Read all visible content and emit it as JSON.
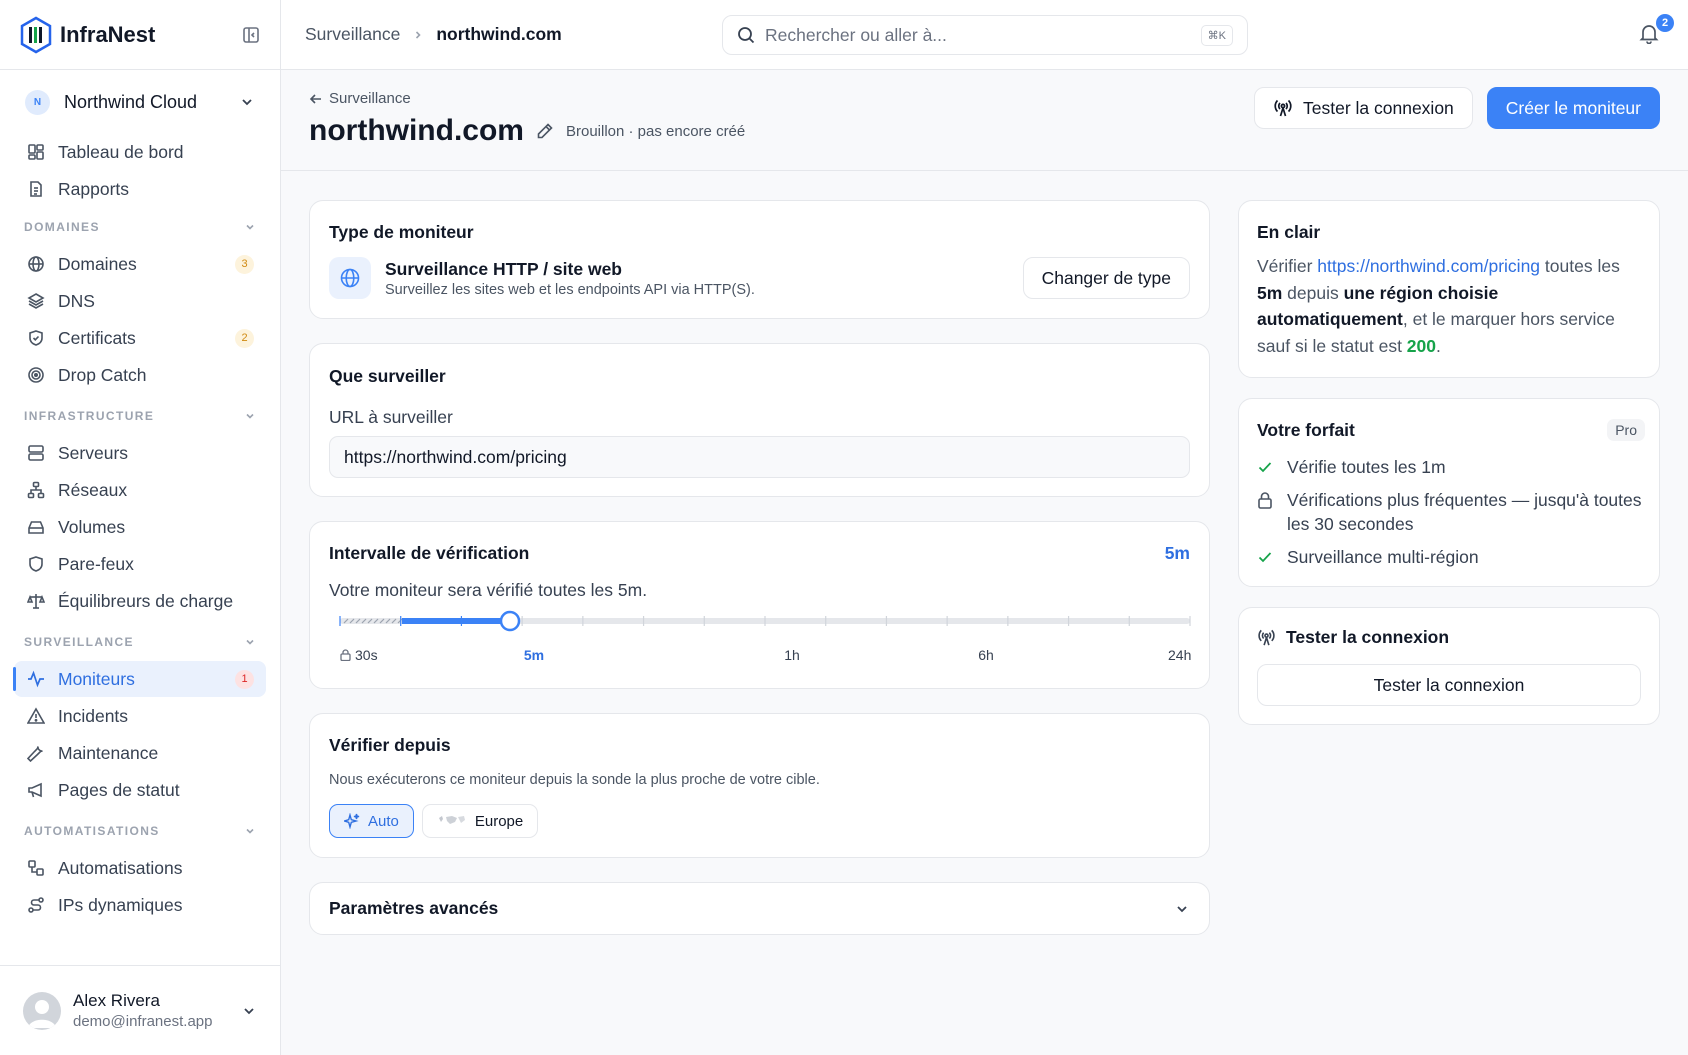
{
  "brand": {
    "name": "InfraNest"
  },
  "org": {
    "initial": "N",
    "name": "Northwind Cloud"
  },
  "nav": {
    "top": [
      {
        "label": "Tableau de bord",
        "icon": "dashboard-icon"
      },
      {
        "label": "Rapports",
        "icon": "report-icon"
      }
    ],
    "sections": [
      {
        "title": "DOMAINES",
        "items": [
          {
            "label": "Domaines",
            "badge": "3"
          },
          {
            "label": "DNS"
          },
          {
            "label": "Certificats",
            "badge": "2"
          },
          {
            "label": "Drop Catch"
          }
        ]
      },
      {
        "title": "INFRASTRUCTURE",
        "items": [
          {
            "label": "Serveurs"
          },
          {
            "label": "Réseaux"
          },
          {
            "label": "Volumes"
          },
          {
            "label": "Pare-feux"
          },
          {
            "label": "Équilibreurs de charge"
          }
        ]
      },
      {
        "title": "SURVEILLANCE",
        "items": [
          {
            "label": "Moniteurs",
            "badge": "1"
          },
          {
            "label": "Incidents"
          },
          {
            "label": "Maintenance"
          },
          {
            "label": "Pages de statut"
          }
        ]
      },
      {
        "title": "AUTOMATISATIONS",
        "items": [
          {
            "label": "Automatisations"
          },
          {
            "label": "IPs dynamiques"
          }
        ]
      }
    ]
  },
  "user": {
    "name": "Alex Rivera",
    "email": "demo@infranest.app"
  },
  "topbar": {
    "breadcrumb": [
      "Surveillance",
      "northwind.com"
    ],
    "search_placeholder": "Rechercher ou aller à...",
    "shortcut": "⌘K",
    "notifications": "2"
  },
  "header": {
    "back_label": "Surveillance",
    "title": "northwind.com",
    "status": "Brouillon · pas encore créé",
    "test_button": "Tester la connexion",
    "create_button": "Créer le moniteur"
  },
  "monitor_type": {
    "heading": "Type de moniteur",
    "name": "Surveillance HTTP / site web",
    "description": "Surveillez les sites web et les endpoints API via HTTP(S).",
    "change_button": "Changer de type"
  },
  "target": {
    "heading": "Que surveiller",
    "url_label": "URL à surveiller",
    "url_value": "https://northwind.com/pricing"
  },
  "interval": {
    "heading": "Intervalle de vérification",
    "value": "5m",
    "description": "Votre moniteur sera vérifié toutes les 5m.",
    "slider_position": 0.2,
    "labels": [
      "30s",
      "5m",
      "1h",
      "6h",
      "24h"
    ]
  },
  "region": {
    "heading": "Vérifier depuis",
    "description": "Nous exécuterons ce moniteur depuis la sonde la plus proche de votre cible.",
    "options": [
      "Auto",
      "Europe"
    ],
    "selected": "Auto"
  },
  "advanced": {
    "heading": "Paramètres avancés"
  },
  "summary": {
    "heading": "En clair",
    "p1": "Vérifier ",
    "url": "https://northwind.com/pricing",
    "p2": " toutes les ",
    "interval": "5m",
    "p3": " depuis ",
    "region": "une région choisie automatiquement",
    "p4": ", et le marquer hors service sauf si le statut est ",
    "status": "200",
    "p5": "."
  },
  "plan": {
    "heading": "Votre forfait",
    "tier": "Pro",
    "features": [
      {
        "text": "Vérifie toutes les 1m",
        "icon": "check-icon"
      },
      {
        "text": "Vérifications plus fréquentes — jusqu'à toutes les 30 secondes",
        "icon": "lock-icon"
      },
      {
        "text": "Surveillance multi-région",
        "icon": "check-icon"
      }
    ]
  },
  "test_card": {
    "heading": "Tester la connexion",
    "button": "Tester la connexion"
  },
  "colors": {
    "accent": "#3b82f6",
    "success": "#16a34a",
    "warning": "#d08a12",
    "danger": "#dc2626"
  }
}
